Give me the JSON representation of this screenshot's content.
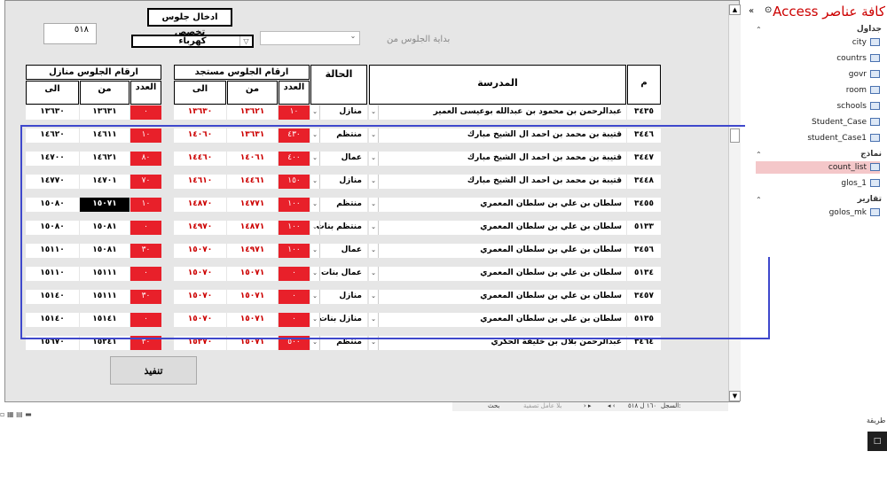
{
  "form": {
    "title": "ادخال جلوس تخصص",
    "record_count": "٥١٨",
    "category_value": "كهرباء",
    "start_label": "بداية الجلوس من",
    "exec_label": "تنفيذ"
  },
  "headers": {
    "m": "م",
    "school": "المدرسة",
    "status": "الحالة",
    "new_group": "ارقام الجلوس مستجد",
    "home_group": "ارقام الجلوس منازل",
    "count": "العدد",
    "from": "من",
    "to": "الى"
  },
  "rows": [
    {
      "m": "٣٤٣٥",
      "school": "عبدالرحمن بن محمود بن عبدالله بوعيسى العمير",
      "status": "منازل",
      "new_count": "١٠",
      "new_from": "١٣٦٢١",
      "new_to": "١٣٦٣٠",
      "home_count": "٠",
      "home_from": "١٣٦٣١",
      "home_to": "١٣٦٣٠"
    },
    {
      "m": "٣٤٤٦",
      "school": "قتيبة بن محمد بن احمد ال الشيخ مبارك",
      "status": "منتظم",
      "new_count": "٤٣٠",
      "new_from": "١٣٦٣١",
      "new_to": "١٤٠٦٠",
      "home_count": "١٠",
      "home_from": "١٤٦١١",
      "home_to": "١٤٦٢٠"
    },
    {
      "m": "٣٤٤٧",
      "school": "قتيبة بن محمد بن احمد ال الشيخ مبارك",
      "status": "عمال",
      "new_count": "٤٠٠",
      "new_from": "١٤٠٦١",
      "new_to": "١٤٤٦٠",
      "home_count": "٨٠",
      "home_from": "١٤٦٢١",
      "home_to": "١٤٧٠٠"
    },
    {
      "m": "٣٤٤٨",
      "school": "قتيبة بن محمد بن احمد ال الشيخ مبارك",
      "status": "منازل",
      "new_count": "١٥٠",
      "new_from": "١٤٤٦١",
      "new_to": "١٤٦١٠",
      "home_count": "٧٠",
      "home_from": "١٤٧٠١",
      "home_to": "١٤٧٧٠"
    },
    {
      "m": "٣٤٥٥",
      "school": "سلطان بن علي بن سلطان المعمري",
      "status": "منتظم",
      "new_count": "١٠٠",
      "new_from": "١٤٧٧١",
      "new_to": "١٤٨٧٠",
      "home_count": "١٠",
      "home_from": "١٥٠٧١",
      "home_to": "١٥٠٨٠"
    },
    {
      "m": "٥١٣٣",
      "school": "سلطان بن علي بن سلطان المعمري",
      "status": "منتظم بنات",
      "new_count": "١٠٠",
      "new_from": "١٤٨٧١",
      "new_to": "١٤٩٧٠",
      "home_count": "٠",
      "home_from": "١٥٠٨١",
      "home_to": "١٥٠٨٠"
    },
    {
      "m": "٣٤٥٦",
      "school": "سلطان بن علي بن سلطان المعمري",
      "status": "عمال",
      "new_count": "١٠٠",
      "new_from": "١٤٩٧١",
      "new_to": "١٥٠٧٠",
      "home_count": "٣٠",
      "home_from": "١٥٠٨١",
      "home_to": "١٥١١٠"
    },
    {
      "m": "٥١٣٤",
      "school": "سلطان بن علي بن سلطان المعمري",
      "status": "عمال بنات",
      "new_count": "٠",
      "new_from": "١٥٠٧١",
      "new_to": "١٥٠٧٠",
      "home_count": "٠",
      "home_from": "١٥١١١",
      "home_to": "١٥١١٠"
    },
    {
      "m": "٣٤٥٧",
      "school": "سلطان بن علي بن سلطان المعمري",
      "status": "منازل",
      "new_count": "٠",
      "new_from": "١٥٠٧١",
      "new_to": "١٥٠٧٠",
      "home_count": "٣٠",
      "home_from": "١٥١١١",
      "home_to": "١٥١٤٠"
    },
    {
      "m": "٥١٣٥",
      "school": "سلطان بن علي بن سلطان المعمري",
      "status": "منازل بنات",
      "new_count": "٠",
      "new_from": "١٥٠٧١",
      "new_to": "١٥٠٧٠",
      "home_count": "٠",
      "home_from": "١٥١٤١",
      "home_to": "١٥١٤٠"
    },
    {
      "m": "٣٤٦٤",
      "school": "عبدالرحمن بلال بن خليفة الحكري",
      "status": "منتظم",
      "new_count": "٥٠٠",
      "new_from": "١٥٠٧١",
      "new_to": "١٥٢٧٠",
      "home_count": "٣٠",
      "home_from": "١٥٢٤١",
      "home_to": "١٥٦٧٠"
    }
  ],
  "navbar": {
    "record_label": "السجل:",
    "record_pos": "١٦٠ ل ٥١٨",
    "filter_label": "بلا عامل تصفية",
    "search_label": "بحث"
  },
  "nav_pane": {
    "title": "كافة عناصر Access",
    "groups": [
      {
        "label": "جداول",
        "items": [
          "city",
          "countrs",
          "govr",
          "room",
          "schools",
          "Student_Case",
          "student_Case1"
        ]
      },
      {
        "label": "نماذج",
        "items": [
          "count_list",
          "glos_1"
        ]
      },
      {
        "label": "تقارير",
        "items": [
          "golos_mk"
        ]
      }
    ]
  },
  "side_label": "طريقة"
}
